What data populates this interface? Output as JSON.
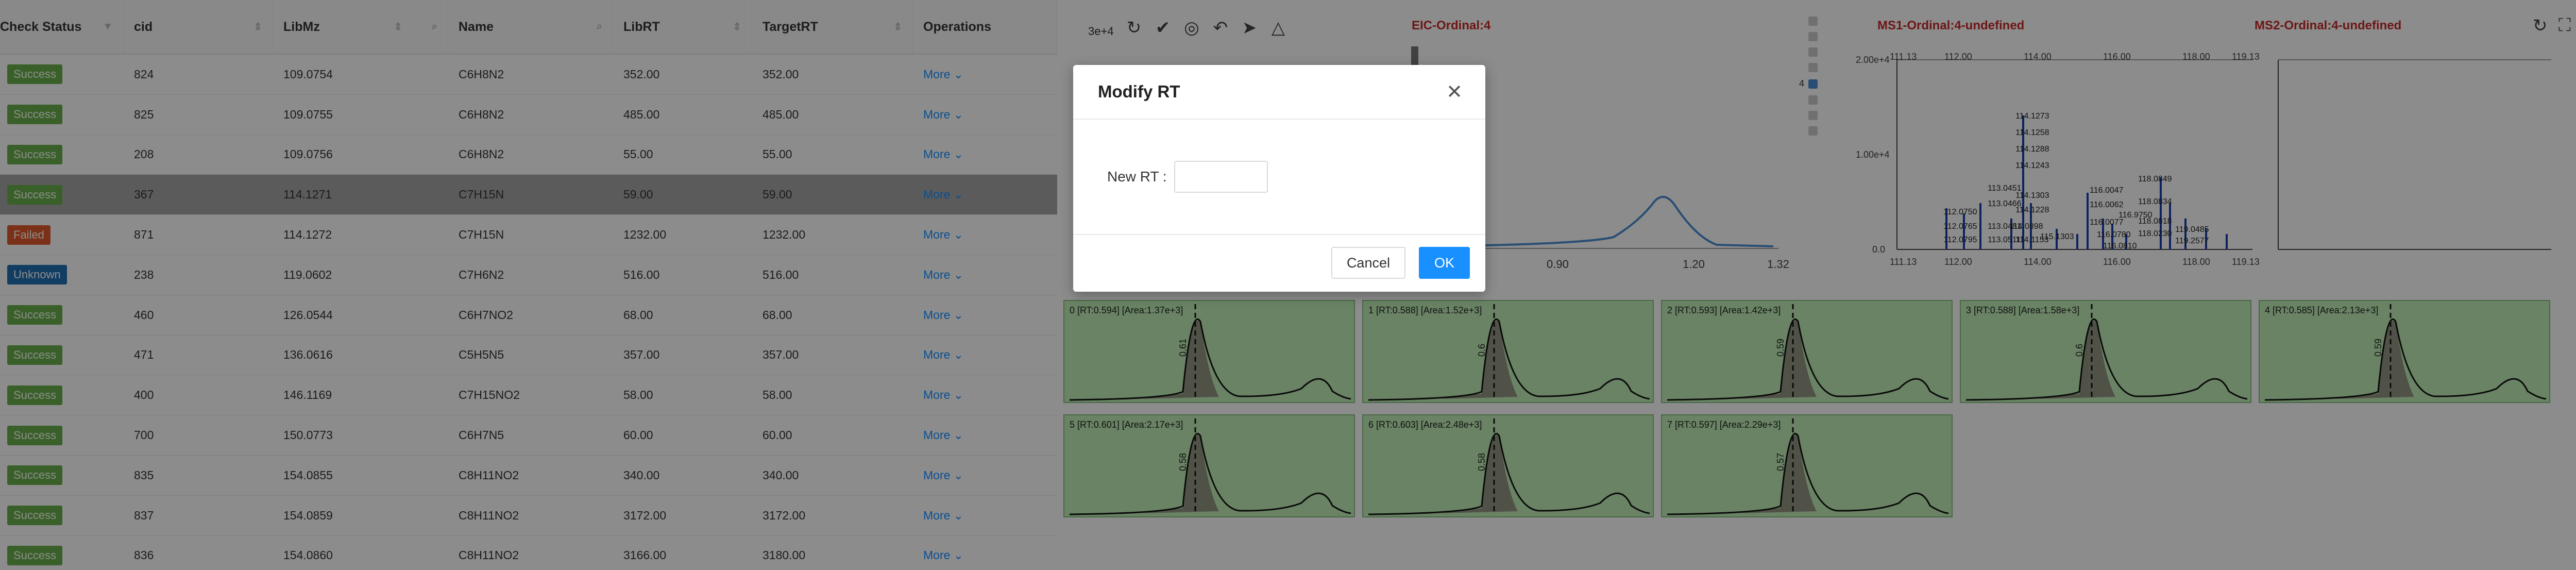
{
  "table": {
    "columns": [
      {
        "label": "Check Status",
        "icon": "filter-icon"
      },
      {
        "label": "cid",
        "icon": "sort-icon"
      },
      {
        "label": "LibMz",
        "icon": "sort-icon"
      },
      {
        "label": "Name",
        "icon": "search-icon"
      },
      {
        "label": "LibRT",
        "icon": "sort-icon"
      },
      {
        "label": "TargetRT",
        "icon": "sort-icon"
      },
      {
        "label": "Operations",
        "icon": ""
      }
    ],
    "rows": [
      {
        "status": "Success",
        "status_color": "#6ab04c",
        "cid": "824",
        "libmz": "109.0754",
        "name": "C6H8N2",
        "librt": "352.00",
        "targetrt": "352.00",
        "op": "More"
      },
      {
        "status": "Success",
        "status_color": "#6ab04c",
        "cid": "825",
        "libmz": "109.0755",
        "name": "C6H8N2",
        "librt": "485.00",
        "targetrt": "485.00",
        "op": "More"
      },
      {
        "status": "Success",
        "status_color": "#6ab04c",
        "cid": "208",
        "libmz": "109.0756",
        "name": "C6H8N2",
        "librt": "55.00",
        "targetrt": "55.00",
        "op": "More"
      },
      {
        "status": "Success",
        "status_color": "#6ab04c",
        "cid": "367",
        "libmz": "114.1271",
        "name": "C7H15N",
        "librt": "59.00",
        "targetrt": "59.00",
        "op": "More"
      },
      {
        "status": "Failed",
        "status_color": "#e05a2a",
        "cid": "871",
        "libmz": "114.1272",
        "name": "C7H15N",
        "librt": "1232.00",
        "targetrt": "1232.00",
        "op": "More"
      },
      {
        "status": "Unknown",
        "status_color": "#1f6fb2",
        "cid": "238",
        "libmz": "119.0602",
        "name": "C7H6N2",
        "librt": "516.00",
        "targetrt": "516.00",
        "op": "More"
      },
      {
        "status": "Success",
        "status_color": "#6ab04c",
        "cid": "460",
        "libmz": "126.0544",
        "name": "C6H7NO2",
        "librt": "68.00",
        "targetrt": "68.00",
        "op": "More"
      },
      {
        "status": "Success",
        "status_color": "#6ab04c",
        "cid": "471",
        "libmz": "136.0616",
        "name": "C5H5N5",
        "librt": "357.00",
        "targetrt": "357.00",
        "op": "More"
      },
      {
        "status": "Success",
        "status_color": "#6ab04c",
        "cid": "400",
        "libmz": "146.1169",
        "name": "C7H15NO2",
        "librt": "58.00",
        "targetrt": "58.00",
        "op": "More"
      },
      {
        "status": "Success",
        "status_color": "#6ab04c",
        "cid": "700",
        "libmz": "150.0773",
        "name": "C6H7N5",
        "librt": "60.00",
        "targetrt": "60.00",
        "op": "More"
      },
      {
        "status": "Success",
        "status_color": "#6ab04c",
        "cid": "835",
        "libmz": "154.0855",
        "name": "C8H11NO2",
        "librt": "340.00",
        "targetrt": "340.00",
        "op": "More"
      },
      {
        "status": "Success",
        "status_color": "#6ab04c",
        "cid": "837",
        "libmz": "154.0859",
        "name": "C8H11NO2",
        "librt": "3172.00",
        "targetrt": "3172.00",
        "op": "More"
      },
      {
        "status": "Success",
        "status_color": "#6ab04c",
        "cid": "836",
        "libmz": "154.0860",
        "name": "C8H11NO2",
        "librt": "3166.00",
        "targetrt": "3180.00",
        "op": "More"
      }
    ],
    "selected_row_index": 3
  },
  "right_panel": {
    "toolbar_icons": [
      "refresh-icon",
      "check-circle-icon",
      "target-icon",
      "undo-icon",
      "send-icon",
      "warning-triangle-icon"
    ],
    "eic_title": "EIC-Ordinal:4",
    "eic_y_label": "3e+4",
    "eic_x_ticks": [
      "0.90",
      "1.20",
      "1.32"
    ],
    "ms1_title": "MS1-Ordinal:4-undefined",
    "ms2_title": "MS2-Ordinal:4-undefined",
    "ms1_x_ticks": [
      "111.13",
      "112.00",
      "114.00",
      "116.00",
      "118.00",
      "119.13"
    ],
    "ms1_y_ticks": [
      "2.00e+4",
      "1.00e+4",
      "0.0"
    ],
    "ms1_peak_labels": [
      "114.1273",
      "114.1258",
      "114.1288",
      "114.1243",
      "113.0451",
      "114.1303",
      "114.1228",
      "113.0466",
      "112.0750",
      "112.0765",
      "113.0481",
      "112.0795",
      "113.0511",
      "114.0898",
      "114.1153",
      "115.1303",
      "116.0047",
      "116.0062",
      "116.0077",
      "116.0780",
      "116.0810",
      "116.9750",
      "118.0849",
      "118.0834",
      "118.0818",
      "118.0230",
      "119.0485",
      "119.2577"
    ],
    "ordinal_list": [
      "4"
    ],
    "tiles": [
      {
        "label": "0 [RT:0.594] [Area:1.37e+3]",
        "rt": "0.61"
      },
      {
        "label": "1 [RT:0.588] [Area:1.52e+3]",
        "rt": "0.6"
      },
      {
        "label": "2 [RT:0.593] [Area:1.42e+3]",
        "rt": "0.59"
      },
      {
        "label": "3 [RT:0.588] [Area:1.58e+3]",
        "rt": "0.6"
      },
      {
        "label": "4 [RT:0.585] [Area:2.13e+3]",
        "rt": "0.59"
      },
      {
        "label": "5 [RT:0.601] [Area:2.17e+3]",
        "rt": "0.58"
      },
      {
        "label": "6 [RT:0.603] [Area:2.48e+3]",
        "rt": "0.58"
      },
      {
        "label": "7 [RT:0.597] [Area:2.29e+3]",
        "rt": "0.57"
      }
    ]
  },
  "dialog": {
    "title": "Modify RT",
    "field_label": "New RT :",
    "field_value": "",
    "cancel_label": "Cancel",
    "ok_label": "OK"
  },
  "colors": {
    "success": "#6ab04c",
    "failed": "#e05a2a",
    "unknown": "#1f6fb2",
    "primary": "#1890ff",
    "chart_title": "#c62828",
    "tile_bg": "#bfeeb6"
  }
}
